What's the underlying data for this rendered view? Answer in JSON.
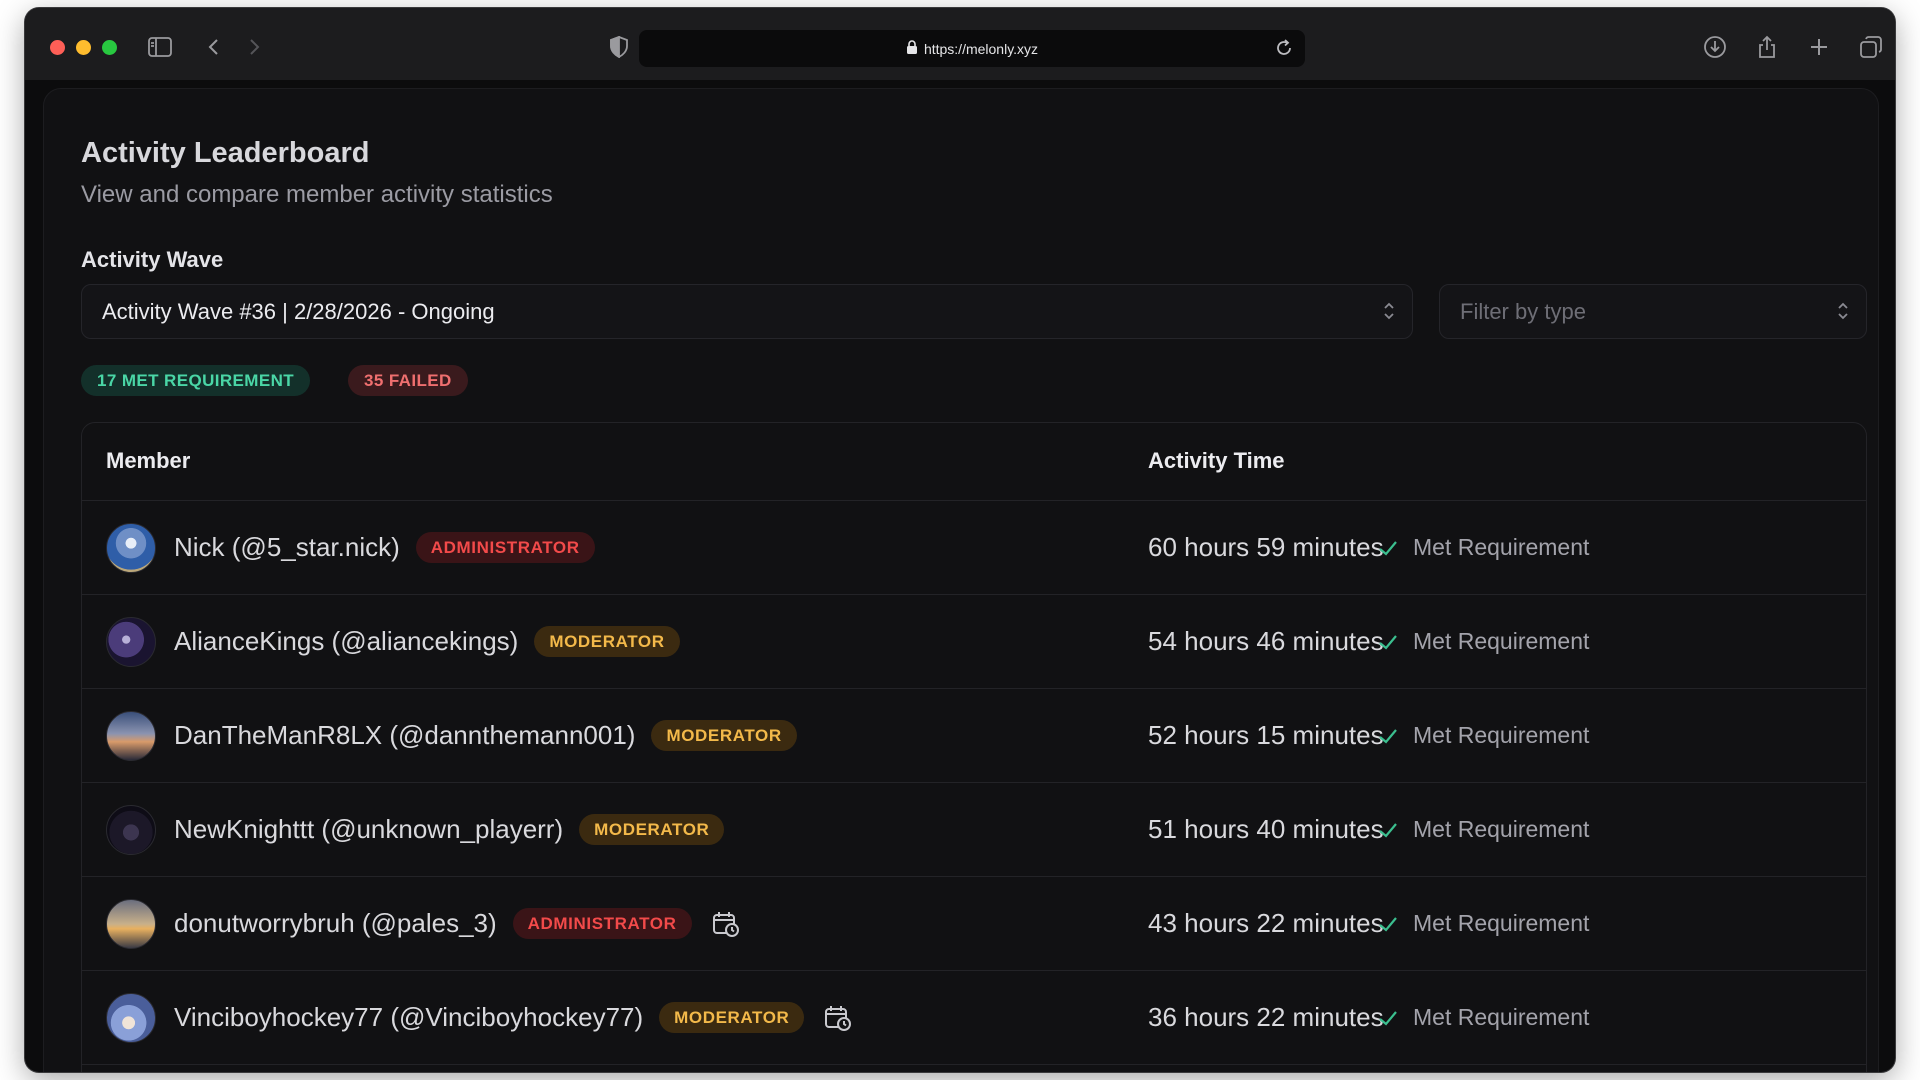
{
  "browser": {
    "url": "https://melonly.xyz"
  },
  "header": {
    "title": "Activity Leaderboard",
    "subtitle": "View and compare member activity statistics"
  },
  "wave": {
    "label": "Activity Wave",
    "selected": "Activity Wave #36 | 2/28/2026 - Ongoing"
  },
  "filter": {
    "placeholder": "Filter by type"
  },
  "summary": {
    "met": "17 MET REQUIREMENT",
    "failed": "35 FAILED"
  },
  "table": {
    "columns": [
      "Member",
      "Activity Time"
    ],
    "rows": [
      {
        "name": "Nick (@5_star.nick)",
        "role": "ADMINISTRATOR",
        "time": "60 hours 59 minutes",
        "status": "Met Requirement"
      },
      {
        "name": "AlianceKings (@aliancekings)",
        "role": "MODERATOR",
        "time": "54 hours 46 minutes",
        "status": "Met Requirement"
      },
      {
        "name": "DanTheManR8LX (@dannthemann001)",
        "role": "MODERATOR",
        "time": "52 hours 15 minutes",
        "status": "Met Requirement"
      },
      {
        "name": "NewKnighttt (@unknown_playerr)",
        "role": "MODERATOR",
        "time": "51 hours 40 minutes",
        "status": "Met Requirement"
      },
      {
        "name": "donutworrybruh (@pales_3)",
        "role": "ADMINISTRATOR",
        "time": "43 hours 22 minutes",
        "status": "Met Requirement"
      },
      {
        "name": "Vinciboyhockey77 (@Vinciboyhockey77)",
        "role": "MODERATOR",
        "time": "36 hours 22 minutes",
        "status": "Met Requirement"
      }
    ]
  },
  "colors": {
    "met_green": "#4ad6a6",
    "failed_red": "#ef6f6f",
    "admin_red": "#f24a4a",
    "moderator_amber": "#f3b94a"
  }
}
